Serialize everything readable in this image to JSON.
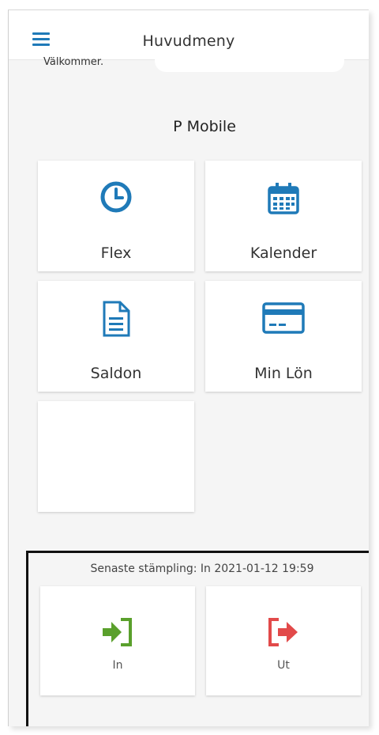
{
  "header": {
    "title": "Huvudmeny",
    "menu_icon": "hamburger-menu-icon"
  },
  "welcome": {
    "greeting": "Välkommer.",
    "app_name": "P Mobile"
  },
  "tiles": [
    {
      "label": "Flex",
      "icon": "clock-icon"
    },
    {
      "label": "Kalender",
      "icon": "calendar-icon"
    },
    {
      "label": "Saldon",
      "icon": "document-icon"
    },
    {
      "label": "Min Lön",
      "icon": "credit-card-icon"
    },
    {
      "label": "",
      "icon": ""
    }
  ],
  "stamping": {
    "last_stamp": "Senaste stämpling: In 2021-01-12 19:59",
    "in_label": "In",
    "out_label": "Ut",
    "in_icon": "sign-in-icon",
    "out_icon": "sign-out-icon"
  },
  "colors": {
    "accent": "#1f7ab8",
    "in_green": "#5aa02c",
    "out_red": "#e24a4a"
  }
}
